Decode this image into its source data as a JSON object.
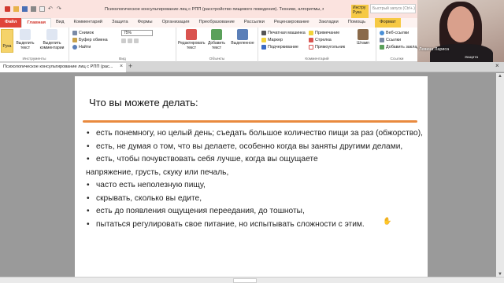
{
  "window": {
    "title": "Психологическое консультирование лиц с РПП (расстройство пищевого поведения). Техники, алгоритмы, м...",
    "instrument_context": "Инстру Рука",
    "quick_search_placeholder": "Быстрый запуск (Ctrl+.)"
  },
  "tabs": [
    "Файл",
    "Главная",
    "Вид",
    "Комментарий",
    "Защита",
    "Формы",
    "Организация",
    "Преобразование",
    "Рассылки",
    "Рецензирование",
    "Закладки",
    "Помощь"
  ],
  "format_tab": "Формат",
  "ribbon": {
    "hand": "Рука",
    "select_text": "Выделить текст",
    "select_comments": "Выделить комментарии",
    "group_tools": "Инструменты",
    "snapshot": "Снимок",
    "clipboard": "Буфер обмена",
    "find": "Найти",
    "zoom_value": "75%",
    "group_view": "Вид",
    "edit": "Редактировать текст",
    "add": "Добавить текст",
    "selected": "Выделенное",
    "group_objects": "Объекты",
    "typewriter": "Печатная машинка",
    "marker": "Маркер",
    "underline": "Подчеркивание",
    "note": "Примечание",
    "arrow": "Стрелка",
    "rectangle": "Прямоугольник",
    "stamp": "Штамп",
    "group_comment": "Комментарий",
    "weblinks": "Веб-ссылки",
    "links": "Ссылки",
    "add_bookmark": "Добавить заклад",
    "group_links": "Ссылки",
    "group_protect": "Защита"
  },
  "webcam": {
    "name": "Левина Лариса"
  },
  "document_tab": {
    "title": "Психологическое консультирование лиц с РПП (рас..."
  },
  "page": {
    "heading": "Что вы можете делать:",
    "items": [
      {
        "bullet": true,
        "text": "есть понемногу, но целый день; съедать большое количество пищи за раз (обжорство),"
      },
      {
        "bullet": true,
        "text": "есть, не думая о том, что вы делаете, особенно когда вы заняты другими делами,"
      },
      {
        "bullet": true,
        "text": "есть, чтобы почувствовать себя лучше, когда вы ощущаете"
      },
      {
        "bullet": false,
        "text": "напряжение, грусть, скуку или печаль,"
      },
      {
        "bullet": true,
        "text": "часто есть неполезную пищу,"
      },
      {
        "bullet": true,
        "text": "скрывать, сколько вы едите,"
      },
      {
        "bullet": true,
        "text": "есть до появления ощущения переедания, до тошноты,"
      },
      {
        "bullet": true,
        "text": "пытаться регулировать свое питание, но испытывать сложности с этим."
      }
    ]
  },
  "status": {
    "page_box": ""
  },
  "colors": {
    "file_tab": "#e0443a",
    "accent_rule": "#e98a3f",
    "format_tab": "#f6c944"
  }
}
